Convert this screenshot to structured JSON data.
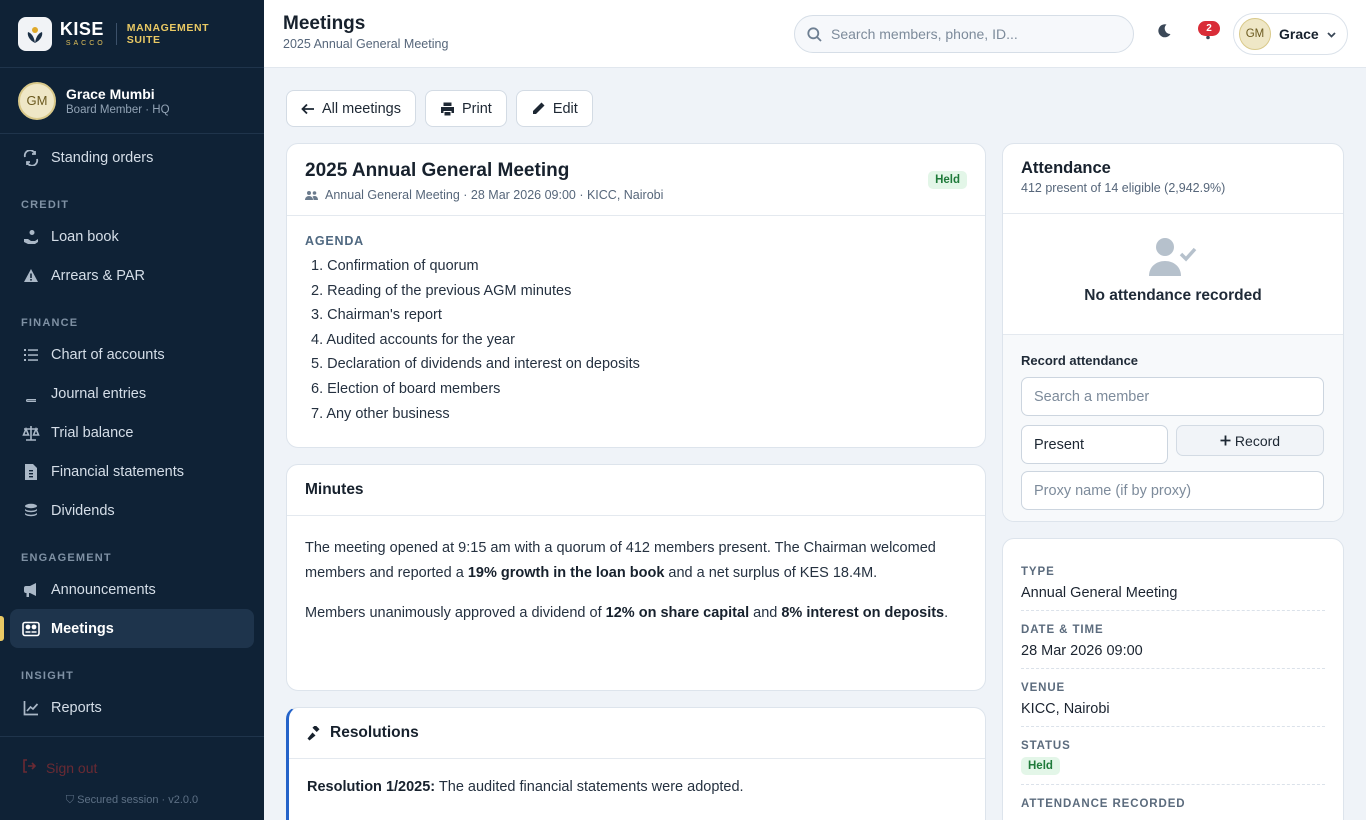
{
  "brand": {
    "name": "KISE",
    "tagline": "SACCO",
    "suite": "MANAGEMENT SUITE"
  },
  "sidebar": {
    "user": {
      "initials": "GM",
      "name": "Grace Mumbi",
      "role": "Board Member · HQ"
    },
    "top_items": [
      {
        "label": "Standing orders",
        "icon": "repeat-icon"
      }
    ],
    "sections": [
      {
        "title": "CREDIT",
        "items": [
          {
            "label": "Loan book",
            "icon": "hand-coins-icon"
          },
          {
            "label": "Arrears & PAR",
            "icon": "warning-icon"
          }
        ]
      },
      {
        "title": "FINANCE",
        "items": [
          {
            "label": "Chart of accounts",
            "icon": "list-icon"
          },
          {
            "label": "Journal entries",
            "icon": "book-icon"
          },
          {
            "label": "Trial balance",
            "icon": "scale-icon"
          },
          {
            "label": "Financial statements",
            "icon": "file-invoice-icon"
          },
          {
            "label": "Dividends",
            "icon": "coins-icon"
          }
        ]
      },
      {
        "title": "ENGAGEMENT",
        "items": [
          {
            "label": "Announcements",
            "icon": "megaphone-icon"
          },
          {
            "label": "Meetings",
            "icon": "people-board-icon",
            "active": true
          }
        ]
      },
      {
        "title": "INSIGHT",
        "items": [
          {
            "label": "Reports",
            "icon": "chart-line-icon"
          }
        ]
      }
    ],
    "signout": "Sign out",
    "secured": "Secured session · v2.0.0"
  },
  "header": {
    "title": "Meetings",
    "subtitle": "2025 Annual General Meeting",
    "search_placeholder": "Search members, phone, ID...",
    "notifications": "2",
    "user_initials": "GM",
    "user_name": "Grace"
  },
  "toolbar": {
    "back": "All meetings",
    "print": "Print",
    "edit": "Edit"
  },
  "meeting": {
    "title": "2025 Annual General Meeting",
    "meta": "Annual General Meeting · 28 Mar 2026 09:00 · KICC, Nairobi",
    "status": "Held",
    "agenda_title": "AGENDA",
    "agenda": [
      "1. Confirmation of quorum",
      "2. Reading of the previous AGM minutes",
      "3. Chairman's report",
      "4. Audited accounts for the year",
      "5. Declaration of dividends and interest on deposits",
      "6. Election of board members",
      "7. Any other business"
    ]
  },
  "minutes": {
    "title": "Minutes",
    "p1_a": "The meeting opened at 9:15 am with a quorum of 412 members present. The Chairman welcomed members and reported a ",
    "p1_b": "19% growth in the loan book",
    "p1_c": " and a net surplus of KES 18.4M.",
    "p2_a": "Members unanimously approved a dividend of ",
    "p2_b": "12% on share capital",
    "p2_c": " and ",
    "p2_d": "8% interest on deposits",
    "p2_e": "."
  },
  "resolutions": {
    "title": "Resolutions",
    "items": [
      {
        "ref": "Resolution 1/2025:",
        "text": " The audited financial statements were adopted."
      }
    ]
  },
  "attendance": {
    "title": "Attendance",
    "summary": "412 present of 14 eligible (2,942.9%)",
    "empty": "No attendance recorded",
    "record_label": "Record attendance",
    "member_placeholder": "Search a member",
    "status_value": "Present",
    "record_button": "Record",
    "proxy_placeholder": "Proxy name (if by proxy)"
  },
  "details": {
    "type_label": "TYPE",
    "type": "Annual General Meeting",
    "datetime_label": "DATE & TIME",
    "datetime": "28 Mar 2026 09:00",
    "venue_label": "VENUE",
    "venue": "KICC, Nairobi",
    "status_label": "STATUS",
    "status": "Held",
    "attendance_label": "ATTENDANCE RECORDED"
  },
  "colors": {
    "sidebar": "#0f2236",
    "accent": "#e9c964",
    "held_bg": "#e3f6e8",
    "held_fg": "#1f7a3a",
    "resolution_border": "#2563c9",
    "badge": "#d92d38"
  }
}
